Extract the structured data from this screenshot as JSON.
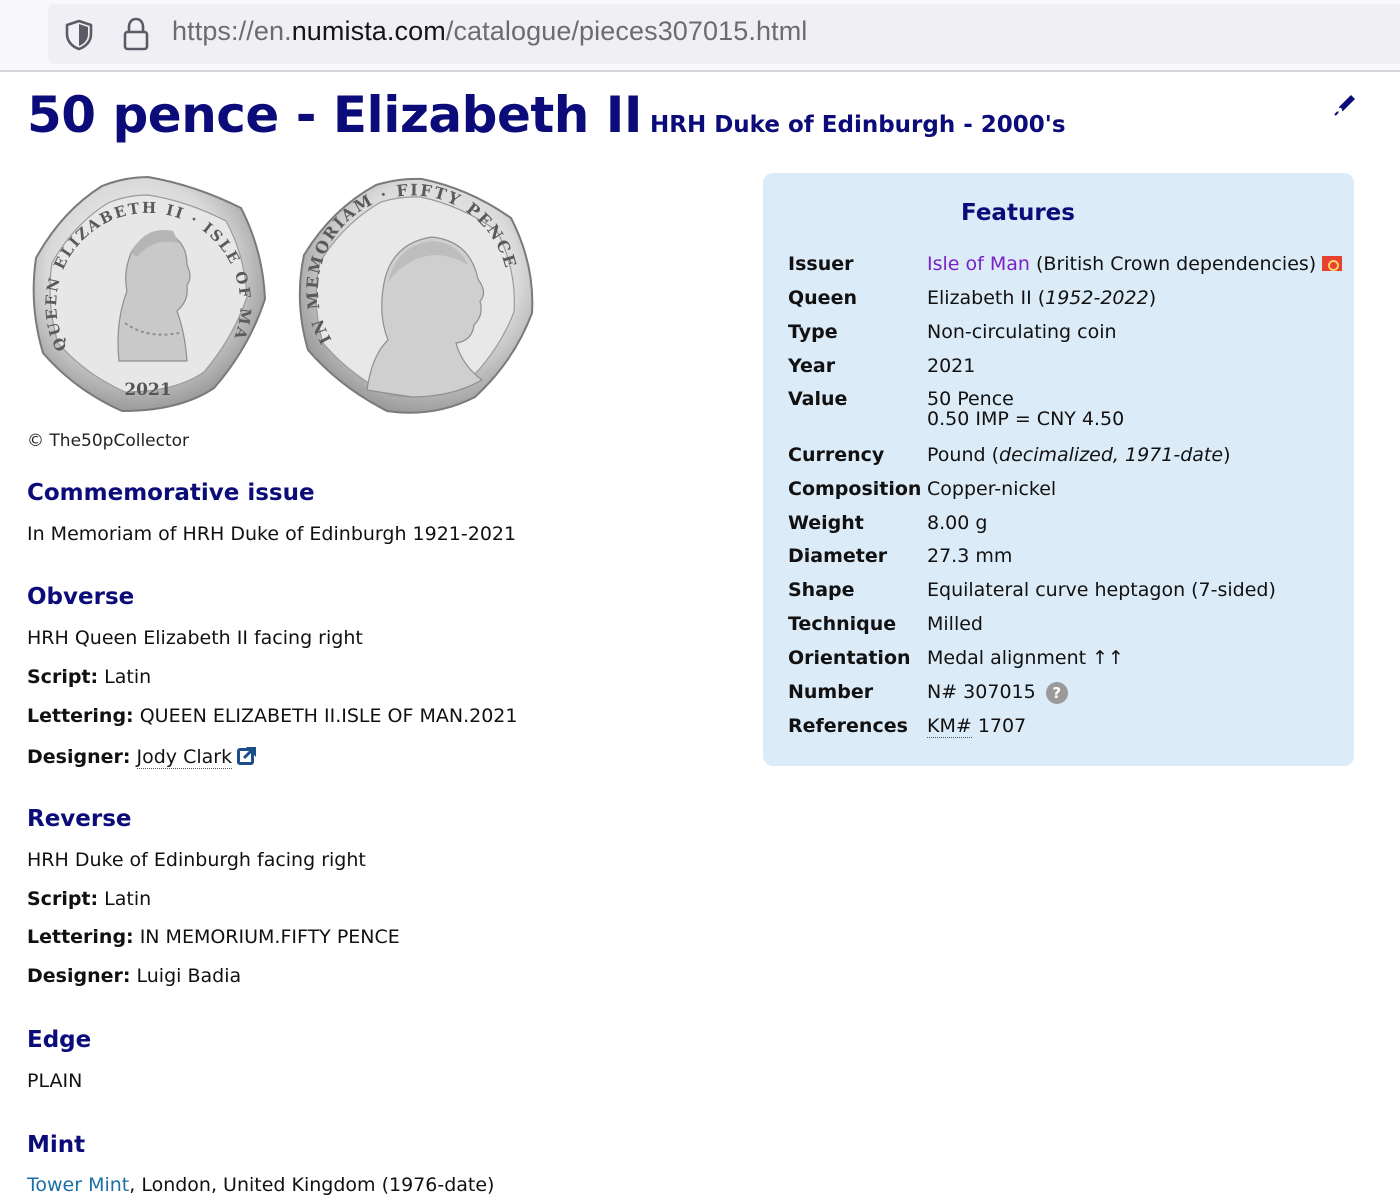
{
  "browser": {
    "url_prefix": "https://en.",
    "url_domain": "numista.com",
    "url_path": "/catalogue/pieces307015.html"
  },
  "page": {
    "title": "50 pence - Elizabeth II",
    "subtitle": "HRH Duke of Edinburgh - 2000's",
    "copyright": "© The50pCollector"
  },
  "coin_images": {
    "obverse_text_top": "QUEEN ELIZABETH II · ISLE OF MAN",
    "obverse_year": "2021",
    "reverse_text": "IN MEMORIAM · FIFTY PENCE"
  },
  "sections": {
    "commemorative": {
      "heading": "Commemorative issue",
      "text": "In Memoriam of HRH Duke of Edinburgh 1921-2021"
    },
    "obverse": {
      "heading": "Obverse",
      "description": "HRH Queen Elizabeth II facing right",
      "script_label": "Script:",
      "script_value": "Latin",
      "lettering_label": "Lettering:",
      "lettering_value": "QUEEN ELIZABETH II.ISLE OF MAN.2021",
      "designer_label": "Designer:",
      "designer_value": "Jody Clark"
    },
    "reverse": {
      "heading": "Reverse",
      "description": "HRH Duke of Edinburgh facing right",
      "script_label": "Script:",
      "script_value": "Latin",
      "lettering_label": "Lettering:",
      "lettering_value": "IN MEMORIUM.FIFTY PENCE",
      "designer_label": "Designer:",
      "designer_value": "Luigi Badia"
    },
    "edge": {
      "heading": "Edge",
      "text": "PLAIN"
    },
    "mint": {
      "heading": "Mint",
      "link": "Tower Mint",
      "rest": ", London, United Kingdom (1976-date)"
    }
  },
  "features": {
    "heading": "Features",
    "issuer_label": "Issuer",
    "issuer_link": "Isle of Man",
    "issuer_rest": " (British Crown dependencies)",
    "queen_label": "Queen",
    "queen_link": "Elizabeth II (",
    "queen_years": "1952-2022",
    "queen_close": ")",
    "type_label": "Type",
    "type_value": "Non-circulating coin",
    "year_label": "Year",
    "year_value": "2021",
    "value_label": "Value",
    "value_line1": "50 Pence",
    "value_line2": "0.50 IMP = CNY 4.50",
    "currency_label": "Currency",
    "currency_prefix": "Pound (",
    "currency_italic": "decimalized, 1971-date",
    "currency_suffix": ")",
    "composition_label": "Composition",
    "composition_value": "Copper-nickel",
    "weight_label": "Weight",
    "weight_value": "8.00 g",
    "diameter_label": "Diameter",
    "diameter_value": "27.3 mm",
    "shape_label": "Shape",
    "shape_value": "Equilateral curve heptagon (7-sided)",
    "technique_label": "Technique",
    "technique_value": "Milled",
    "orientation_label": "Orientation",
    "orientation_value": "Medal alignment ↑↑",
    "number_label": "Number",
    "number_value": "N# 307015",
    "references_label": "References",
    "references_prefix": "KM#",
    "references_value": " 1707"
  }
}
